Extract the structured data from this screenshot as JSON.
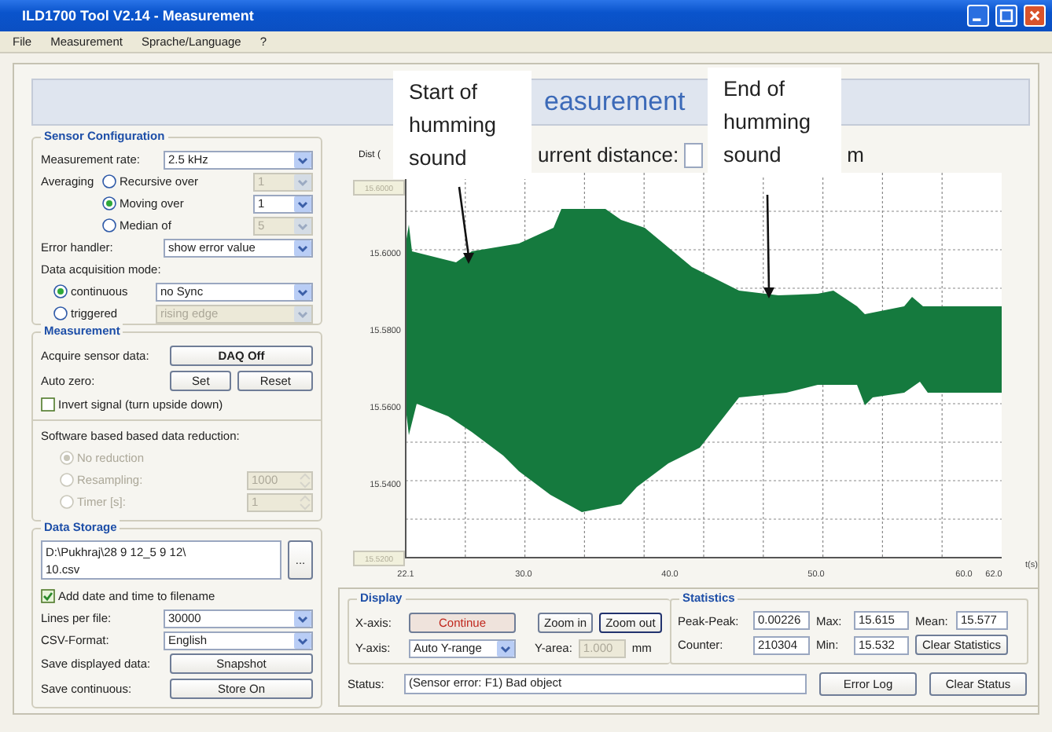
{
  "window": {
    "title": "ILD1700 Tool V2.14 - Measurement"
  },
  "menu": [
    {
      "label": "File"
    },
    {
      "label": "Measurement"
    },
    {
      "label": "Sprache/Language"
    },
    {
      "label": "?"
    }
  ],
  "header": {
    "title": "easurement"
  },
  "groups": [
    {
      "title": "Sensor Configuration",
      "rows": [
        {
          "kind": "select",
          "label": "Measurement rate:",
          "value": "2.5 kHz",
          "disabled": false
        },
        {
          "kind": "radios",
          "label": "Averaging",
          "options": [
            {
              "label": "Recursive over",
              "selected": false,
              "field": {
                "kind": "select",
                "value": "1",
                "disabled": true
              }
            },
            {
              "label": "Moving over",
              "selected": true,
              "field": {
                "kind": "select",
                "value": "1",
                "disabled": false
              }
            },
            {
              "label": "Median of",
              "selected": false,
              "field": {
                "kind": "select",
                "value": "5",
                "disabled": true
              }
            }
          ]
        },
        {
          "kind": "select",
          "label": "Error handler:",
          "value": "show error value",
          "disabled": false
        },
        {
          "kind": "text",
          "label": "Data acquisition mode:"
        },
        {
          "kind": "radios",
          "options": [
            {
              "label": "continuous",
              "selected": true,
              "field": {
                "kind": "select",
                "value": "no Sync",
                "disabled": false
              }
            },
            {
              "label": "triggered",
              "selected": false,
              "field": {
                "kind": "select",
                "value": "rising edge",
                "disabled": true
              }
            }
          ]
        }
      ]
    },
    {
      "title": "Measurement",
      "rows": [
        {
          "kind": "buttons",
          "label": "Acquire sensor data:",
          "buttons": [
            {
              "label": "DAQ Off"
            }
          ]
        },
        {
          "kind": "buttons",
          "label": "Auto zero:",
          "buttons": [
            {
              "label": "Set"
            },
            {
              "label": "Reset"
            }
          ]
        },
        {
          "kind": "check",
          "label": "Invert signal (turn upside down)",
          "checked": false
        },
        {
          "kind": "divider"
        },
        {
          "kind": "text",
          "label": "Software based based data reduction:"
        },
        {
          "kind": "radios",
          "disabled": true,
          "options": [
            {
              "label": "No reduction",
              "selected": true
            },
            {
              "label": "Resampling:",
              "selected": false,
              "field": {
                "kind": "spinner",
                "value": "1000",
                "disabled": true
              }
            },
            {
              "label": "Timer [s]:",
              "selected": false,
              "field": {
                "kind": "spinner",
                "value": "1",
                "disabled": true
              }
            }
          ]
        }
      ]
    },
    {
      "title": "Data Storage",
      "rows": [
        {
          "kind": "path",
          "lines": [
            "D:\\Pukhraj\\28 9 12_5 9 12\\",
            "10.csv"
          ],
          "button": "..."
        },
        {
          "kind": "check",
          "label": "Add date and time to filename",
          "checked": true
        },
        {
          "kind": "select",
          "label": "Lines per file:",
          "value": "30000",
          "disabled": false
        },
        {
          "kind": "select",
          "label": "CSV-Format:",
          "value": "English",
          "disabled": false
        },
        {
          "kind": "buttons",
          "label": "Save displayed data:",
          "buttons": [
            {
              "label": "Snapshot"
            }
          ]
        },
        {
          "kind": "buttons",
          "label": "Save continuous:",
          "buttons": [
            {
              "label": "Store On"
            }
          ]
        }
      ]
    }
  ],
  "distance": {
    "label": "urrent distance:",
    "unit": "m"
  },
  "plot": {
    "y_label": "Dist (",
    "top_box": "15.6000",
    "bottom_box": "15.5200",
    "y_ticks": [
      "15.6000",
      "15.5800",
      "15.5600",
      "15.5400"
    ],
    "x_ticks": [
      "22.1",
      "30.0",
      "40.0",
      "50.0",
      "60.0",
      "62.0"
    ],
    "x_unit": "t(s)"
  },
  "display": {
    "title": "Display",
    "x_axis_label": "X-axis:",
    "buttons": [
      {
        "label": "Continue",
        "attention": true,
        "focused": false
      },
      {
        "label": "Zoom in",
        "attention": false,
        "focused": false
      },
      {
        "label": "Zoom out",
        "attention": false,
        "focused": true
      }
    ],
    "y_axis_label": "Y-axis:",
    "y_axis_value": "Auto Y-range",
    "y_area_label": "Y-area:",
    "y_area_value": "1.000",
    "y_area_disabled": true,
    "y_area_unit": "mm"
  },
  "statistics": {
    "title": "Statistics",
    "items": [
      {
        "label": "Peak-Peak:",
        "value": "0.00226"
      },
      {
        "label": "Max:",
        "value": "15.615"
      },
      {
        "label": "Mean:",
        "value": "15.577"
      },
      {
        "label": "Counter:",
        "value": "210304"
      },
      {
        "label": "Min:",
        "value": "15.532"
      }
    ],
    "button": "Clear Statistics"
  },
  "status": {
    "label": "Status:",
    "value": "(Sensor error: F1) Bad object",
    "buttons": [
      {
        "label": "Error Log"
      },
      {
        "label": "Clear Status"
      }
    ]
  },
  "callouts": [
    {
      "text": "Start of humming sound"
    },
    {
      "text": "End of humming sound"
    }
  ]
}
